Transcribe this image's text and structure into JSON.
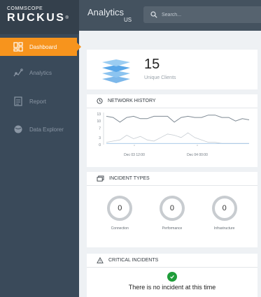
{
  "brand": {
    "top": "COMMSCOPE",
    "name": "RUCKUS"
  },
  "nav": [
    {
      "label": "Dashboard",
      "icon": "dashboard-icon",
      "active": true
    },
    {
      "label": "Analytics",
      "icon": "analytics-icon",
      "active": false
    },
    {
      "label": "Report",
      "icon": "report-icon",
      "active": false
    },
    {
      "label": "Data Explorer",
      "icon": "data-explorer-icon",
      "active": false
    }
  ],
  "header": {
    "title": "Analytics",
    "region": "US",
    "search_placeholder": "Search..."
  },
  "clients": {
    "count": "15",
    "label": "Unique Clients"
  },
  "network_history": {
    "title": "NETWORK HISTORY",
    "y_ticks": [
      "13",
      "10",
      "7",
      "3",
      "0"
    ],
    "x_ticks": [
      "Dec 03 12:00",
      "Dec 04 00:00"
    ],
    "series": [
      {
        "color": "#7f8a94",
        "values": [
          12,
          11.5,
          9.5,
          11.5,
          12,
          11,
          11,
          12,
          12,
          12,
          9.5,
          11.5,
          12,
          11.5,
          11.5,
          12.5,
          12.5,
          11.5,
          11.5,
          10,
          11,
          10.5
        ]
      },
      {
        "color": "#c6ccd2",
        "values": [
          1,
          1.5,
          2,
          4,
          2.5,
          3.5,
          2,
          1.5,
          3,
          4.5,
          4,
          3,
          5,
          3,
          2,
          1,
          1,
          0.5,
          0.5,
          0.5,
          0.5,
          0.5
        ]
      },
      {
        "color": "#9dc3e6",
        "values": [
          0.5,
          0.5,
          0.5,
          0.5,
          0.5,
          0.5,
          0.5,
          0.5,
          0.5,
          0.5,
          0.5,
          0.5,
          0.5,
          0.5,
          0.5,
          0.5,
          0.5,
          0.5,
          0.5,
          0.5,
          0.5,
          0.5
        ]
      }
    ],
    "ylim": [
      0,
      13
    ]
  },
  "incident_types": {
    "title": "INCIDENT TYPES",
    "items": [
      {
        "label": "Connection",
        "value": "0"
      },
      {
        "label": "Performance",
        "value": "0"
      },
      {
        "label": "Infrastructure",
        "value": "0"
      }
    ]
  },
  "critical_incidents": {
    "title": "CRITICAL INCIDENTS",
    "message": "There is no incident at this time"
  },
  "colors": {
    "accent": "#f7941d",
    "sidebar": "#3a4a5a",
    "topbar": "#44525f",
    "ok": "#1f9d3a"
  }
}
